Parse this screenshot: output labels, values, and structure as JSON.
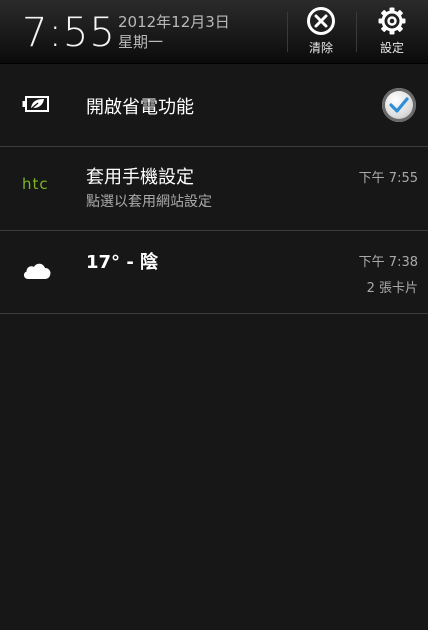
{
  "status": {
    "time": "7:55",
    "date": "2012年12月3日",
    "weekday": "星期一"
  },
  "header_actions": {
    "clear_label": "清除",
    "settings_label": "設定"
  },
  "notifications": {
    "power_saver": {
      "title": "開啟省電功能",
      "checked": true,
      "icon": "battery-leaf-icon"
    },
    "htc": {
      "title": "套用手機設定",
      "subtitle": "點選以套用網站設定",
      "time": "下午 7:55",
      "icon": "htc-logo",
      "logo_text": "htc",
      "logo_color": "#7bb524"
    },
    "weather": {
      "title": "17° - 陰",
      "time": "下午 7:38",
      "cards": "2 張卡片",
      "icon": "cloud-icon"
    }
  },
  "colors": {
    "background": "#171717",
    "divider": "#3c3c3c",
    "checkmark": "#2f8ed8"
  }
}
